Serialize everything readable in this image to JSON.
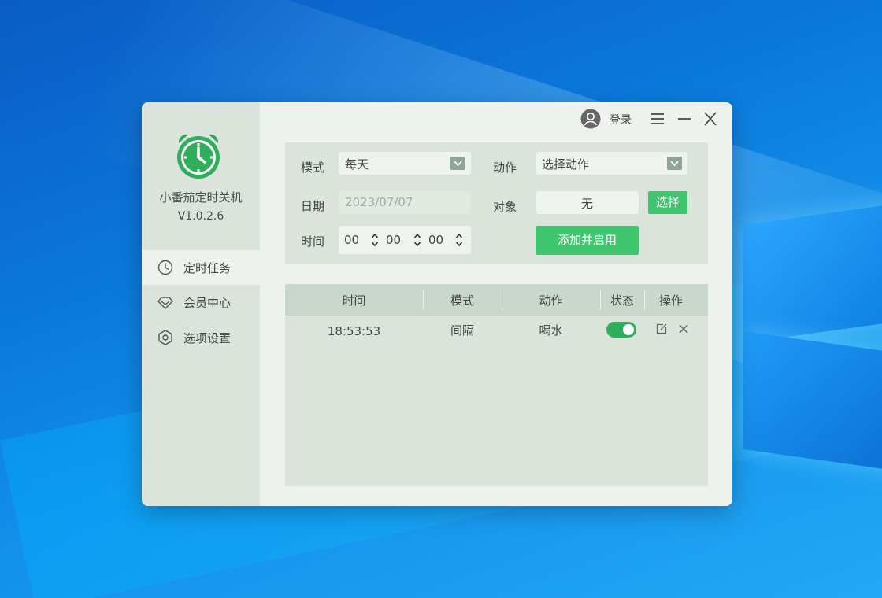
{
  "app": {
    "name": "小番茄定时关机",
    "version": "V1.0.2.6"
  },
  "sidebar": {
    "items": [
      {
        "label": "定时任务",
        "icon": "clock-icon",
        "active": true
      },
      {
        "label": "会员中心",
        "icon": "diamond-icon",
        "active": false
      },
      {
        "label": "选项设置",
        "icon": "settings-icon",
        "active": false
      }
    ]
  },
  "topbar": {
    "login_label": "登录"
  },
  "form": {
    "mode_label": "模式",
    "mode_value": "每天",
    "action_label": "动作",
    "action_value": "选择动作",
    "date_label": "日期",
    "date_value": "2023/07/07",
    "target_label": "对象",
    "target_value": "无",
    "select_button": "选择",
    "time_label": "时间",
    "hour": "00",
    "minute": "00",
    "second": "00",
    "add_button": "添加并启用"
  },
  "table": {
    "columns": [
      "时间",
      "模式",
      "动作",
      "状态",
      "操作"
    ],
    "rows": [
      {
        "time": "18:53:53",
        "mode": "间隔",
        "action": "喝水",
        "enabled": true
      }
    ]
  },
  "colors": {
    "accent": "#3fc66f",
    "toggle_on": "#2fae5c",
    "sidebar_bg": "#dbe4da",
    "main_bg": "#edf2ec"
  }
}
